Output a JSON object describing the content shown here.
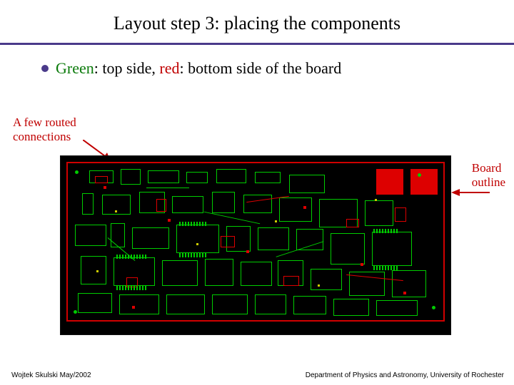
{
  "title": "Layout step 3: placing the components",
  "bullet": {
    "green_label": "Green",
    "sep1": ": top side, ",
    "red_label": "red",
    "sep2": ": bottom side of the board"
  },
  "annot_left_l1": "A few routed",
  "annot_left_l2": "connections",
  "annot_right_l1": "Board",
  "annot_right_l2": "outline",
  "footer_left": "Wojtek Skulski May/2002",
  "footer_right": "Department of Physics and Astronomy, University of Rochester"
}
